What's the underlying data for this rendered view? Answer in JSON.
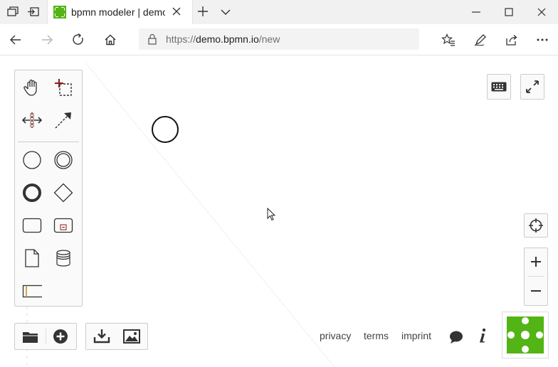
{
  "browser": {
    "tab": {
      "title": "bpmn modeler | demo.bpmn.io"
    },
    "address": {
      "scheme": "https://",
      "host": "demo.bpmn.io",
      "path": "/new"
    },
    "icons": [
      "tab-sets-icon",
      "set-aside-tabs-icon",
      "new-tab-icon",
      "tab-overflow-icon",
      "back-icon",
      "forward-icon",
      "refresh-icon",
      "home-icon",
      "lock-icon",
      "favorites-icon",
      "notes-icon",
      "share-icon",
      "minimize-icon",
      "maximize-icon",
      "close-icon"
    ]
  },
  "palette": {
    "tools": [
      "hand-tool",
      "lasso-tool",
      "space-tool",
      "connect-tool",
      "start-event",
      "intermediate-event",
      "end-event",
      "gateway",
      "task",
      "subprocess",
      "data-object",
      "data-store",
      "participant"
    ]
  },
  "footer": {
    "links": [
      "privacy",
      "terms",
      "imprint"
    ]
  },
  "colors": {
    "brand_green": "#52b415",
    "chrome_bg": "#f1f1f1",
    "palette_bg": "#fafafa",
    "border": "#cccccc"
  }
}
